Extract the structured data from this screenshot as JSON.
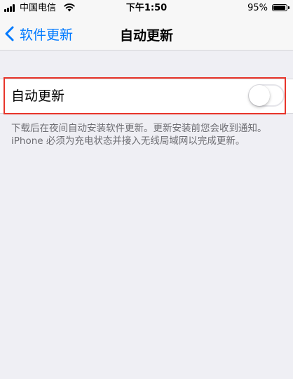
{
  "status_bar": {
    "carrier": "中国电信",
    "time": "下午1:50",
    "battery_percent": "95%",
    "battery_level": 0.95
  },
  "nav": {
    "back_label": "软件更新",
    "title": "自动更新"
  },
  "settings": {
    "auto_update_label": "自动更新",
    "auto_update_enabled": false
  },
  "footer": {
    "text": "下载后在夜间自动安装软件更新。更新安装前您会收到通知。iPhone 必须为充电状态并接入无线局域网以完成更新。"
  },
  "colors": {
    "accent": "#007aff",
    "highlight": "#e8352b",
    "background": "#efeff4"
  },
  "icons": [
    "signal-icon",
    "wifi-icon",
    "battery-icon",
    "back-chevron-icon"
  ]
}
